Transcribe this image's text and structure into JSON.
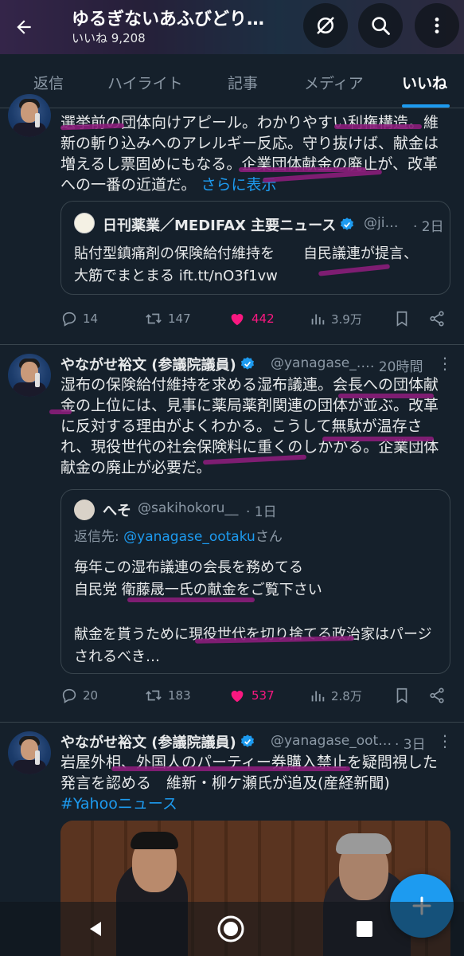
{
  "header": {
    "title": "ゆるぎないあふびどり…",
    "subtitle": "いいね 9,208"
  },
  "tabs": [
    "返信",
    "ハイライト",
    "記事",
    "メディア",
    "いいね"
  ],
  "active_tab_index": 4,
  "colors": {
    "background": "#15202b",
    "accent": "#1d9bf0",
    "like": "#f91880",
    "marker": "#8a1d7a",
    "muted": "#8b98a5"
  },
  "tweets": [
    {
      "text": "選挙前の団体向けアピール。わかりやすい利権構造。維新の斬り込みへのアレルギー反応。守り抜けば、献金は増えるし票固めにもなる。企業団体献金の廃止が、改革への一番の近道だ。",
      "more": "さらに表示",
      "quote": {
        "name": "日刊薬業／MEDIFAX 主要ニュース",
        "handle": "@ji…",
        "time": "· 2日",
        "text": "貼付型鎮痛剤の保険給付維持を　　自民議連が提言、大筋でまとまる ift.tt/nO3f1vw"
      },
      "actions": {
        "replies": "14",
        "retweets": "147",
        "likes": "442",
        "views": "3.9万"
      }
    },
    {
      "name": "やながせ裕文 (参議院議員)",
      "handle": "@yanagase_…",
      "time": "· 20時間",
      "text": "湿布の保険給付維持を求める湿布議連。会長への団体献金の上位には、見事に薬局薬剤関連の団体が並ぶ。改革に反対する理由がよくわかる。こうして無駄が温存され、現役世代の社会保険料に重くのしかかる。企業団体献金の廃止が必要だ。",
      "quote": {
        "name": "へそ",
        "handle": "@sakihokoru__",
        "time": "· 1日",
        "reply_prefix": "返信先: ",
        "reply_to": "@yanagase_ootaku",
        "reply_suffix": "さん",
        "text": "毎年この湿布議連の会長を務めてる\n自民党 衛藤晟一氏の献金をご覧下さい\n\n献金を貰うために現役世代を切り捨てる政治家はパージされるべき…"
      },
      "actions": {
        "replies": "20",
        "retweets": "183",
        "likes": "537",
        "views": "2.8万"
      }
    },
    {
      "name": "やながせ裕文 (参議院議員)",
      "handle": "@yanagase_oot…",
      "time": "· 3日",
      "text": "岩屋外相、外国人のパーティー券購入禁止を疑問視した発言を認める　維新・柳ケ瀬氏が追及(産経新聞)",
      "hashtag": "#Yahooニュース"
    }
  ],
  "icons": [
    "back-arrow-icon",
    "unfollow-slash-icon",
    "search-icon",
    "more-vertical-icon",
    "reply-icon",
    "retweet-icon",
    "heart-icon",
    "views-icon",
    "bookmark-icon",
    "share-icon",
    "verified-icon",
    "compose-plus-icon",
    "nav-back-icon",
    "nav-home-icon",
    "nav-recents-icon"
  ]
}
